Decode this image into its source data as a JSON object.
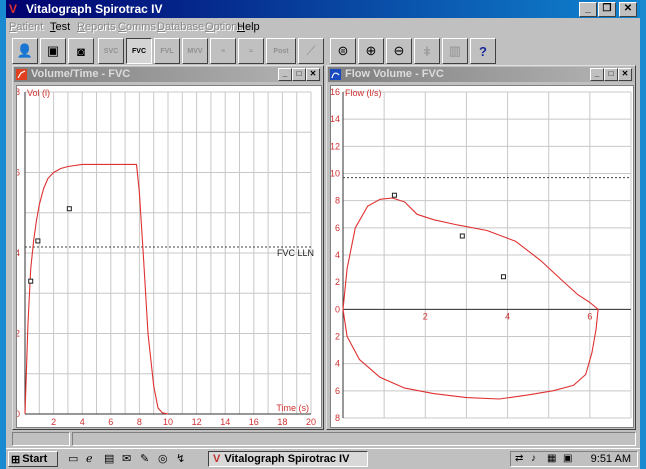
{
  "window": {
    "title": "Vitalograph Spirotrac IV"
  },
  "menu": [
    {
      "label": "Patient",
      "disabled": true
    },
    {
      "label": "Test",
      "disabled": false
    },
    {
      "label": "Reports",
      "disabled": true
    },
    {
      "label": "Comms",
      "disabled": true
    },
    {
      "label": "Database",
      "disabled": true
    },
    {
      "label": "Options",
      "disabled": true
    },
    {
      "label": "Help",
      "disabled": false
    }
  ],
  "toolbar": {
    "fvc_label": "FVC",
    "post_label": "Post",
    "help_label": "?"
  },
  "volume_time": {
    "window_title": "Volume/Time - FVC",
    "y_label": "Vol (l)",
    "x_label": "Time (s)",
    "lln_label": "FVC LLN",
    "curve_color": "#e03030"
  },
  "flow_volume": {
    "window_title": "Flow Volume - FVC",
    "y_label": "Flow (l/s)",
    "curve_color": "#e03030"
  },
  "taskbar": {
    "start_label": "Start",
    "task_label": "Vitalograph Spirotrac IV",
    "clock": "9:51 AM"
  },
  "chart_data": [
    {
      "type": "line",
      "title": "Volume/Time - FVC",
      "xlabel": "Time (s)",
      "ylabel": "Vol (l)",
      "xlim": [
        0,
        20
      ],
      "ylim": [
        0,
        8
      ],
      "xticks": [
        2,
        4,
        6,
        8,
        10,
        12,
        14,
        16,
        18,
        20
      ],
      "yticks": [
        0,
        2,
        4,
        6,
        8
      ],
      "grid": true,
      "reference_line": {
        "label": "FVC LLN",
        "y": 4.15
      },
      "series": [
        {
          "x": [
            0,
            0.2,
            0.4,
            0.6,
            0.8,
            1,
            1.3,
            1.6,
            2,
            2.5,
            3,
            4,
            5,
            6,
            7,
            7.8,
            8,
            8.3,
            8.6,
            9,
            9.3,
            9.6,
            10
          ],
          "y": [
            0,
            2.2,
            3.6,
            4.3,
            4.8,
            5.2,
            5.6,
            5.85,
            6.0,
            6.1,
            6.15,
            6.2,
            6.2,
            6.2,
            6.2,
            6.2,
            5.5,
            3.8,
            2.0,
            0.7,
            0.15,
            0.03,
            0.0
          ]
        }
      ],
      "markers": [
        {
          "x": 0.4,
          "y": 3.3
        },
        {
          "x": 0.9,
          "y": 4.3
        },
        {
          "x": 3.1,
          "y": 5.1
        }
      ]
    },
    {
      "type": "line",
      "title": "Flow Volume - FVC",
      "ylabel": "Flow (l/s)",
      "xlim": [
        0,
        7
      ],
      "ylim": [
        -8,
        16
      ],
      "xticks": [
        2,
        4,
        6
      ],
      "yticks": [
        16,
        14,
        12,
        10,
        8,
        6,
        4,
        2,
        0,
        -2,
        -4,
        -6,
        -8
      ],
      "ytick_labels": [
        "16",
        "14",
        "12",
        "10",
        "8",
        "6",
        "4",
        "2",
        "0",
        "2",
        "4",
        "6",
        "8"
      ],
      "grid": true,
      "reference_line": {
        "y": 9.7
      },
      "series": [
        {
          "x": [
            0,
            0.1,
            0.3,
            0.6,
            0.9,
            1.2,
            1.5,
            1.8,
            2.2,
            2.8,
            3.5,
            4.2,
            4.8,
            5.3,
            5.7,
            6.0,
            6.2,
            6.15,
            6.05,
            5.9,
            5.6,
            5.1,
            4.5,
            3.8,
            3.0,
            2.2,
            1.5,
            0.9,
            0.4,
            0.1,
            0
          ],
          "y": [
            0,
            3.0,
            6.0,
            7.6,
            8.1,
            8.2,
            7.9,
            7.0,
            6.6,
            6.2,
            5.8,
            5.0,
            3.6,
            2.2,
            1.1,
            0.5,
            0,
            -1.5,
            -3.2,
            -4.8,
            -5.6,
            -6.0,
            -6.3,
            -6.6,
            -6.5,
            -6.2,
            -5.8,
            -5.0,
            -3.7,
            -2.0,
            0
          ]
        }
      ],
      "markers": [
        {
          "x": 1.25,
          "y": 8.4
        },
        {
          "x": 2.9,
          "y": 5.4
        },
        {
          "x": 3.9,
          "y": 2.4
        }
      ]
    }
  ]
}
